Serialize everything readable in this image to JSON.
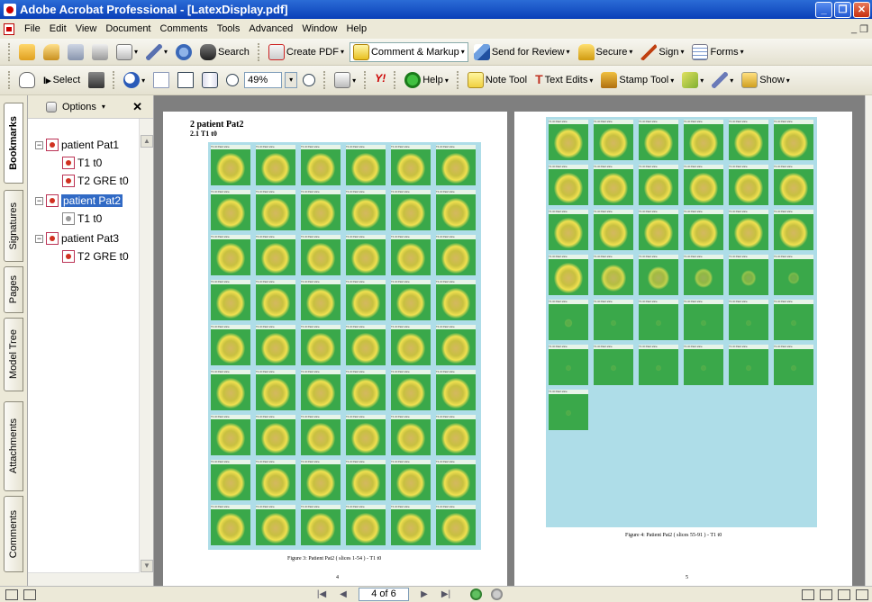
{
  "window": {
    "title": "Adobe Acrobat Professional - [LatexDisplay.pdf]"
  },
  "menu": [
    "File",
    "Edit",
    "View",
    "Document",
    "Comments",
    "Tools",
    "Advanced",
    "Window",
    "Help"
  ],
  "toolbar1": {
    "search": "Search",
    "create_pdf": "Create PDF",
    "comment_markup": "Comment & Markup",
    "send_review": "Send for Review",
    "secure": "Secure",
    "sign": "Sign",
    "forms": "Forms"
  },
  "toolbar2": {
    "select": "Select",
    "zoom": "49%",
    "yahoo": "Y!",
    "help": "Help",
    "note_tool": "Note Tool",
    "text_edits": "Text Edits",
    "stamp_tool": "Stamp Tool",
    "show": "Show"
  },
  "nav_tabs": [
    "Bookmarks",
    "Signatures",
    "Pages",
    "Model Tree",
    "Attachments",
    "Comments"
  ],
  "bookmarks_panel": {
    "options": "Options",
    "items": [
      {
        "label": "patient Pat1",
        "level": 0
      },
      {
        "label": "T1 t0",
        "level": 1
      },
      {
        "label": "T2 GRE t0",
        "level": 1
      },
      {
        "label": "patient Pat2",
        "level": 0,
        "selected": true
      },
      {
        "label": "T1 t0",
        "level": 1
      },
      {
        "label": "patient Pat3",
        "level": 0
      },
      {
        "label": "T2 GRE t0",
        "level": 1
      }
    ]
  },
  "document": {
    "page_left": {
      "section": "2   patient Pat2",
      "subsection": "2.1   T1 t0",
      "caption": "Figure 3: Patient Pat2 ( slices 1-54 ) - T1 t0",
      "page_number": "4"
    },
    "page_right": {
      "caption": "Figure 4: Patient Pat2 ( slices 55-91 ) - T1 t0",
      "page_number": "5"
    },
    "cell_label": "T1 t0 Pat2 slice"
  },
  "status": {
    "page_indicator": "4 of 6"
  }
}
